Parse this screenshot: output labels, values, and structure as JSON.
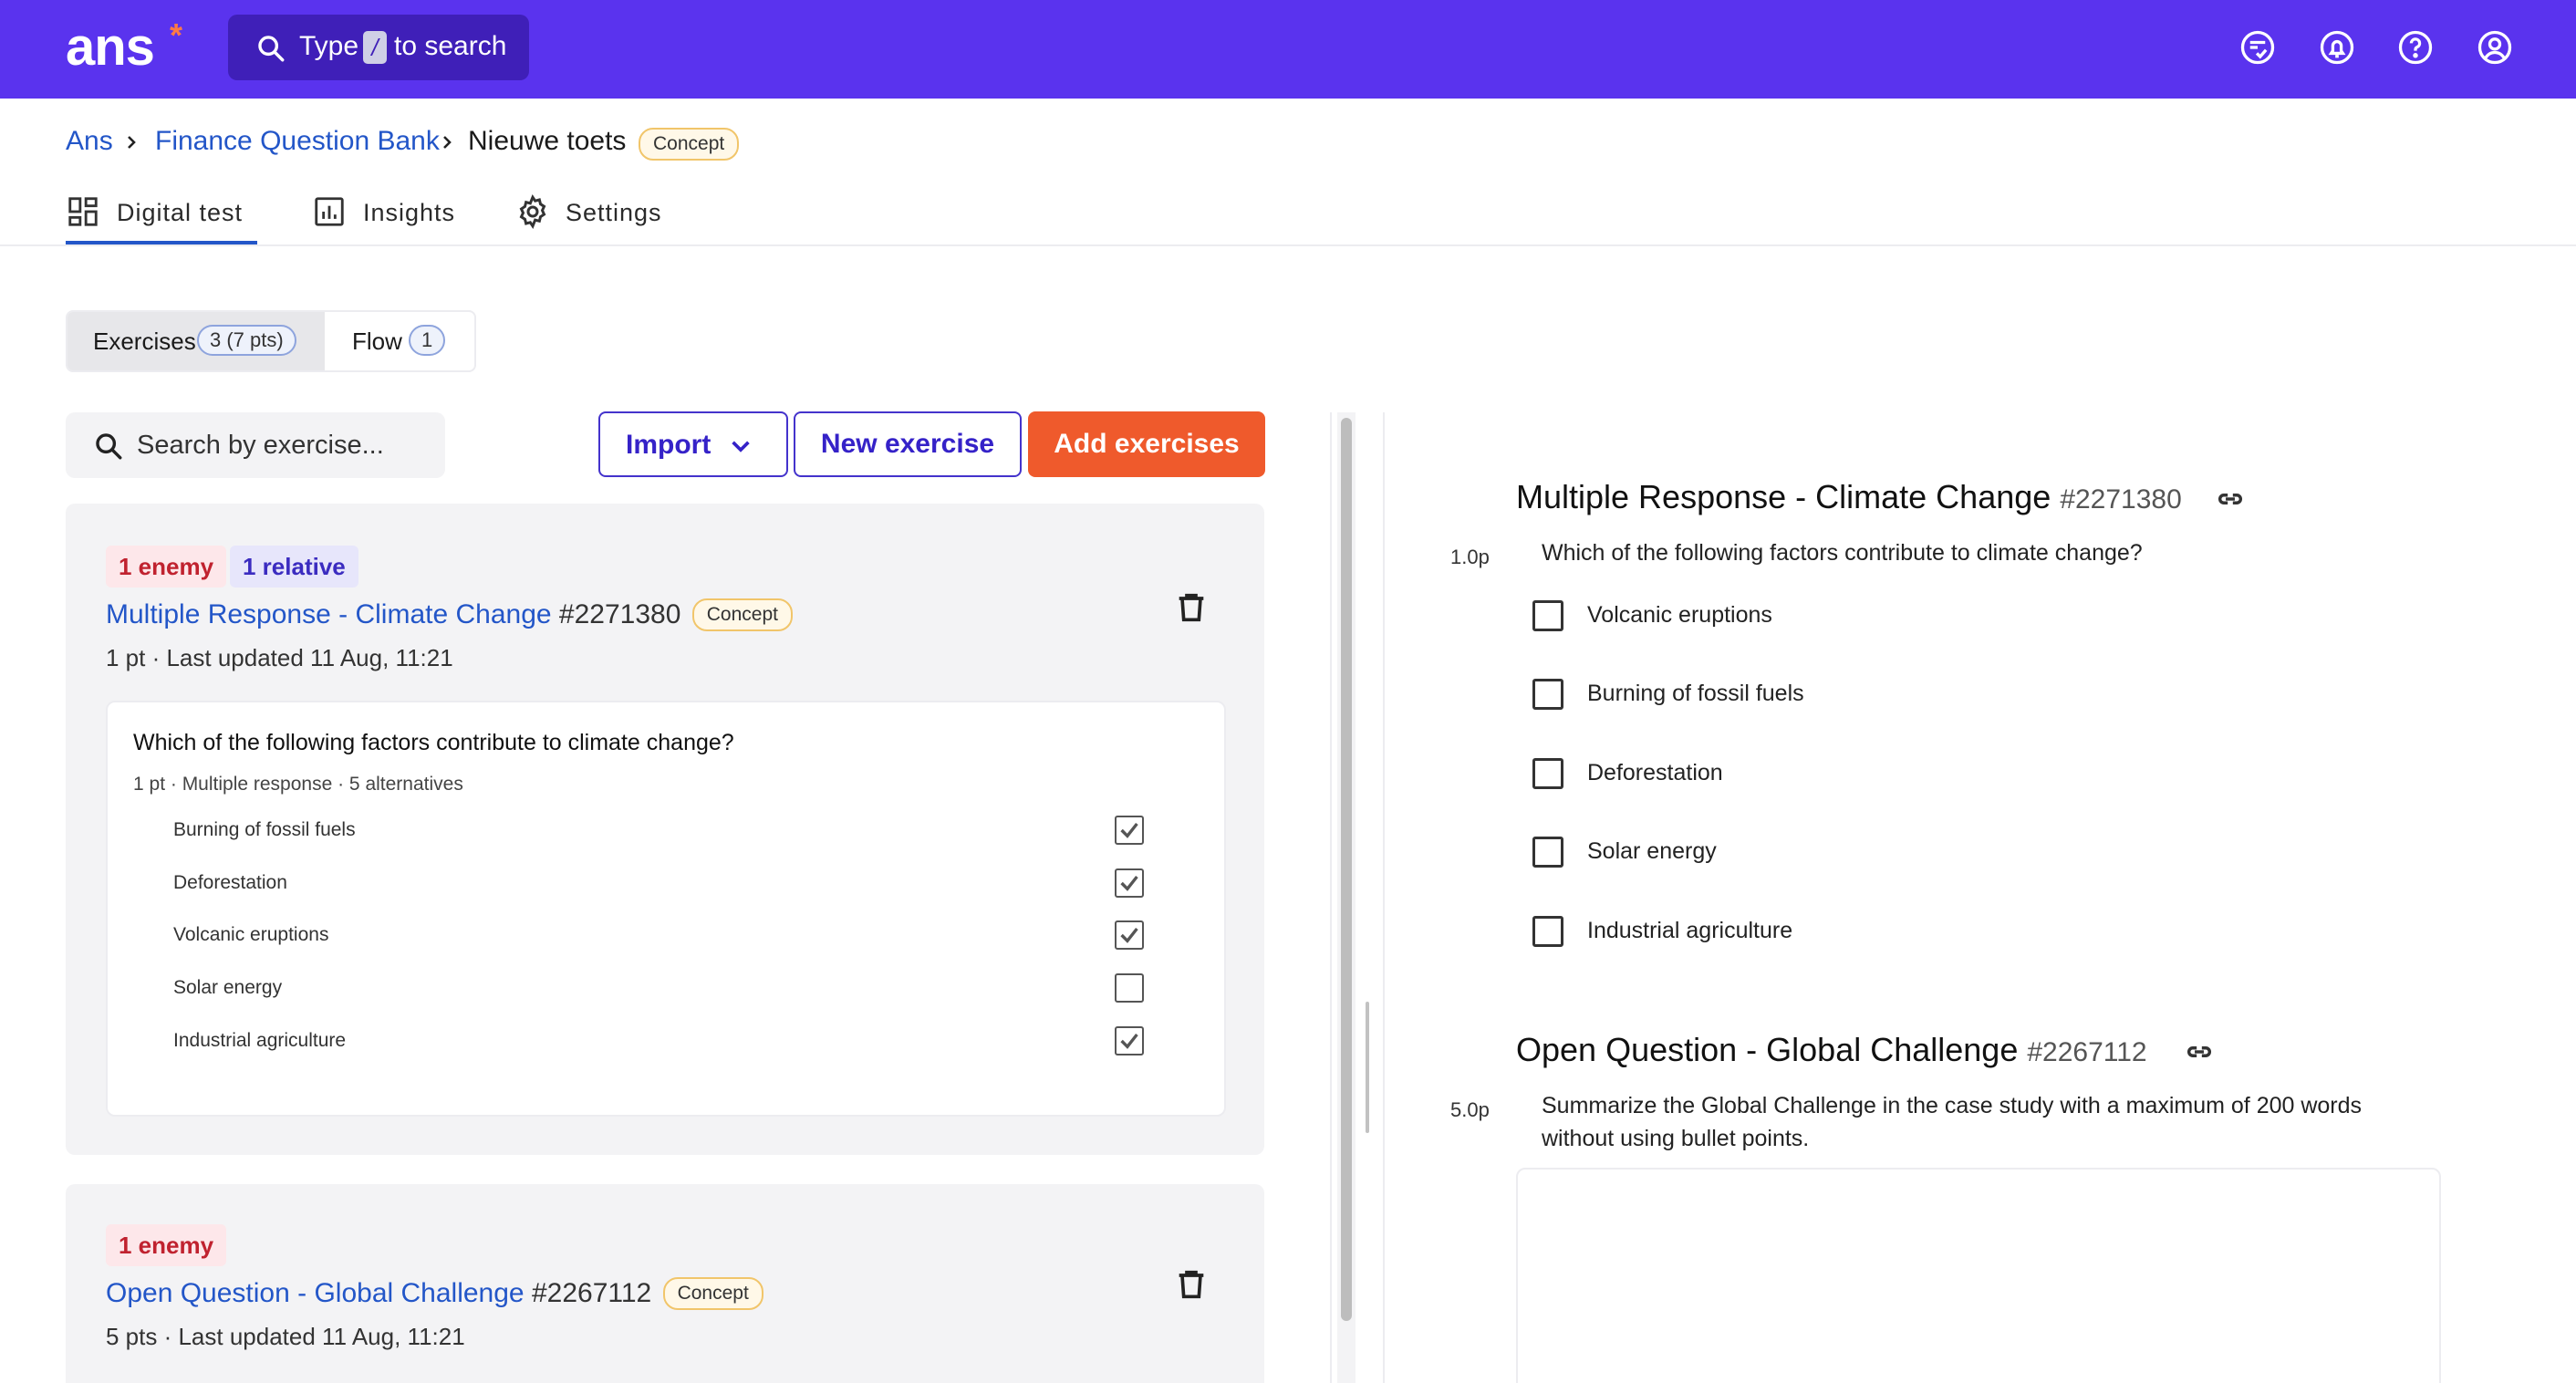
{
  "topbar": {
    "logo": "ans",
    "logo_mark": "*",
    "search": {
      "prefix": "Type",
      "key": "/",
      "suffix": "to search"
    },
    "icons": [
      "review-icon",
      "bell-icon",
      "help-icon",
      "account-icon"
    ]
  },
  "breadcrumb": {
    "items": [
      "Ans",
      "Finance Question Bank",
      "Nieuwe toets"
    ],
    "status": "Concept"
  },
  "tabs": [
    {
      "label": "Digital test",
      "icon": "dashboard-icon",
      "active": true
    },
    {
      "label": "Insights",
      "icon": "bar-chart-icon",
      "active": false
    },
    {
      "label": "Settings",
      "icon": "gear-icon",
      "active": false
    }
  ],
  "segment": {
    "exercises_label": "Exercises",
    "exercises_count": "3 (7 pts)",
    "flow_label": "Flow",
    "flow_count": "1"
  },
  "toolbar": {
    "search_placeholder": "Search by exercise...",
    "import_label": "Import",
    "new_label": "New exercise",
    "add_label": "Add exercises"
  },
  "exercises": [
    {
      "tags": [
        "1 enemy",
        "1 relative"
      ],
      "title": "Multiple Response - Climate Change",
      "number": "#2271380",
      "status": "Concept",
      "meta": "1 pt · Last updated 11 Aug, 11:21",
      "question": "Which of the following factors contribute to climate change?",
      "question_meta": "1 pt · Multiple response · 5 alternatives",
      "alternatives": [
        {
          "label": "Burning of fossil fuels",
          "correct": true
        },
        {
          "label": "Deforestation",
          "correct": true
        },
        {
          "label": "Volcanic eruptions",
          "correct": true
        },
        {
          "label": "Solar energy",
          "correct": false
        },
        {
          "label": "Industrial agriculture",
          "correct": true
        }
      ]
    },
    {
      "tags": [
        "1 enemy"
      ],
      "title": "Open Question - Global Challenge",
      "number": "#2267112",
      "status": "Concept",
      "meta": "5 pts · Last updated 11 Aug, 11:21"
    }
  ],
  "preview": {
    "items": [
      {
        "title": "Multiple Response - Climate Change",
        "number": "#2271380",
        "points": "1.0p",
        "question": "Which of the following factors contribute to climate change?",
        "options": [
          "Volcanic eruptions",
          "Burning of fossil fuels",
          "Deforestation",
          "Solar energy",
          "Industrial agriculture"
        ]
      },
      {
        "title": "Open Question - Global Challenge",
        "number": "#2267112",
        "points": "5.0p",
        "question_line1": "Summarize the Global Challenge in the case study with a maximum of 200 words",
        "question_line2": "without using bullet points."
      }
    ]
  },
  "colors": {
    "brand": "#5a33ee",
    "accent": "#ef5a2c",
    "link": "#2356c8",
    "enemy": "#c0222f",
    "relative": "#3b2cc0"
  }
}
